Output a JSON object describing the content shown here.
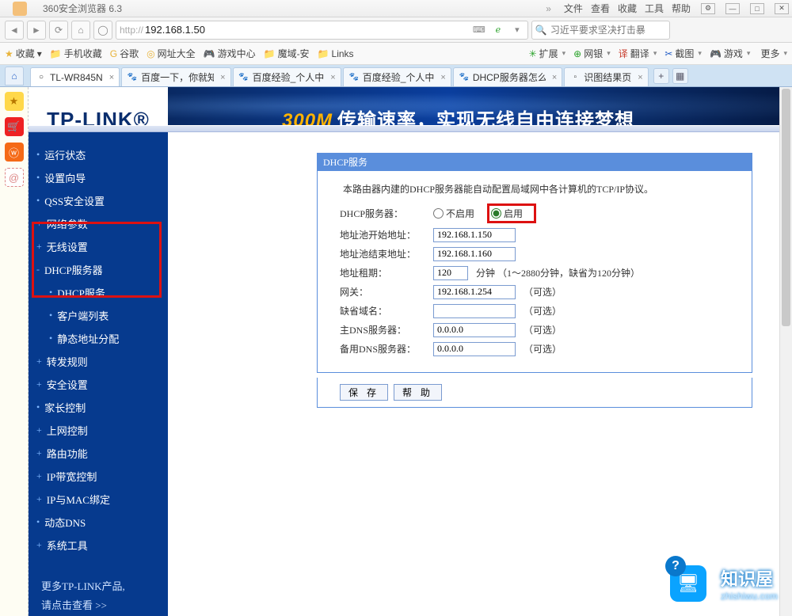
{
  "browser": {
    "title": "360安全浏览器 6.3",
    "nav_chevrons": "»",
    "menus": [
      "文件",
      "查看",
      "收藏",
      "工具",
      "帮助"
    ],
    "window_btns": {
      "min": "—",
      "max": "□",
      "close": "✕",
      "extra": "▭"
    },
    "nav_icons": {
      "back": "◄",
      "forward": "►",
      "reload": "⟳",
      "home": "⌂",
      "shield": "◯"
    },
    "address": {
      "prefix": "http://",
      "host": "192.168.1.50",
      "tail": "/"
    },
    "addr_right": {
      "keyboard": "⌨",
      "compat": "ℯ"
    },
    "search_icon": "🔍",
    "search_placeholder": "习近平要求坚决打击暴"
  },
  "bookmarks": {
    "fav_label": "收藏",
    "items": [
      {
        "icon": "📁",
        "label": "手机收藏"
      },
      {
        "icon": "G",
        "label": "谷歌",
        "iconClass": "blue-ico"
      },
      {
        "icon": "◎",
        "label": "网址大全",
        "iconClass": "green-ico"
      },
      {
        "icon": "🎮",
        "label": "游戏中心"
      },
      {
        "icon": "📁",
        "label": "魔域-安"
      },
      {
        "icon": "📁",
        "label": "Links"
      }
    ],
    "right": [
      {
        "icon": "✳",
        "label": "扩展",
        "iconClass": "green-ico"
      },
      {
        "icon": "⊕",
        "label": "网银",
        "iconClass": "green-ico"
      },
      {
        "icon": "译",
        "label": "翻译",
        "iconClass": "red-ico"
      },
      {
        "icon": "✂",
        "label": "截图",
        "iconClass": "blue-ico"
      },
      {
        "icon": "🎮",
        "label": "游戏"
      },
      {
        "icon": "",
        "label": "更多"
      }
    ]
  },
  "tabs": {
    "list": [
      {
        "title": "TL-WR845N",
        "icon": "○",
        "active": true
      },
      {
        "title": "百度一下，你就知",
        "icon": "🐾"
      },
      {
        "title": "百度经验_个人中",
        "icon": "🐾"
      },
      {
        "title": "百度经验_个人中",
        "icon": "🐾"
      },
      {
        "title": "DHCP服务器怎么设",
        "icon": "🐾"
      },
      {
        "title": "识图结果页",
        "icon": "▫"
      }
    ]
  },
  "banner": {
    "logo": "TP-LINK®",
    "speed": "300M",
    "slogan": "传输速率，实现无线自由连接梦想"
  },
  "nav": {
    "items": [
      {
        "label": "运行状态",
        "bullet": "•"
      },
      {
        "label": "设置向导",
        "bullet": "•"
      },
      {
        "label": "QSS安全设置",
        "bullet": "•"
      },
      {
        "label": "网络参数",
        "bullet": "+"
      },
      {
        "label": "无线设置",
        "bullet": "+"
      },
      {
        "label": "DHCP服务器",
        "bullet": "-",
        "expanded": true,
        "children": [
          {
            "label": "DHCP服务"
          },
          {
            "label": "客户端列表"
          },
          {
            "label": "静态地址分配"
          }
        ]
      },
      {
        "label": "转发规则",
        "bullet": "+"
      },
      {
        "label": "安全设置",
        "bullet": "+"
      },
      {
        "label": "家长控制",
        "bullet": "•"
      },
      {
        "label": "上网控制",
        "bullet": "+"
      },
      {
        "label": "路由功能",
        "bullet": "+"
      },
      {
        "label": "IP带宽控制",
        "bullet": "+"
      },
      {
        "label": "IP与MAC绑定",
        "bullet": "+"
      },
      {
        "label": "动态DNS",
        "bullet": "•"
      },
      {
        "label": "系统工具",
        "bullet": "+"
      }
    ],
    "more1": "更多TP-LINK产品,",
    "more2": "请点击查看 >>"
  },
  "panel": {
    "title": "DHCP服务",
    "desc": "本路由器内建的DHCP服务器能自动配置局域网中各计算机的TCP/IP协议。",
    "rows": {
      "server_label": "DHCP服务器：",
      "disable": "不启用",
      "enable": "启用",
      "start_label": "地址池开始地址：",
      "start_val": "192.168.1.150",
      "end_label": "地址池结束地址：",
      "end_val": "192.168.1.160",
      "lease_label": "地址租期：",
      "lease_val": "120",
      "lease_hint": "分钟 （1～2880分钟，缺省为120分钟）",
      "gateway_label": "网关：",
      "gateway_val": "192.168.1.254",
      "domain_label": "缺省域名：",
      "domain_val": "",
      "dns1_label": "主DNS服务器：",
      "dns1_val": "0.0.0.0",
      "dns2_label": "备用DNS服务器：",
      "dns2_val": "0.0.0.0",
      "optional": "（可选）"
    },
    "buttons": {
      "save": "保 存",
      "help": "帮 助"
    }
  },
  "watermark": {
    "text": "知识屋",
    "url": "zhishiwu.com"
  }
}
